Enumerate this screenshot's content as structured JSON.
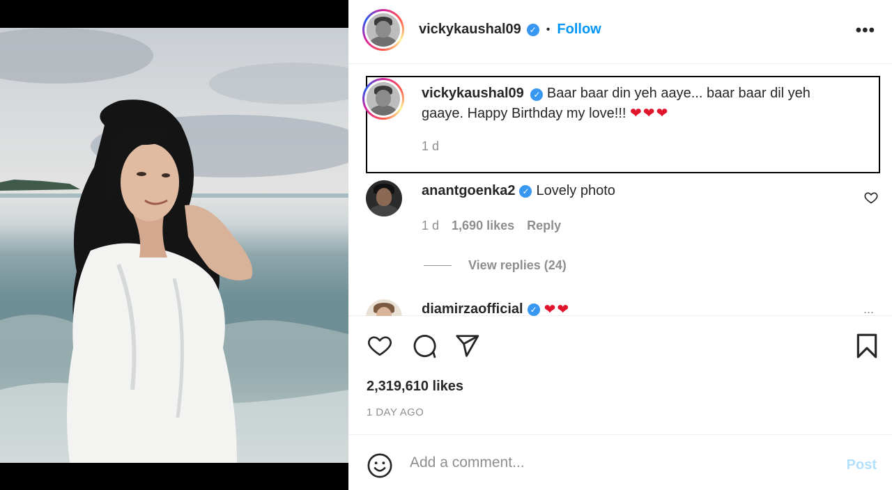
{
  "post": {
    "author": "vickykaushal09",
    "follow_label": "Follow",
    "separator": "•",
    "more_label": "•••",
    "verified_mark": "✓"
  },
  "caption": {
    "username": "vickykaushal09",
    "text": "Baar baar din yeh aaye... baar baar dil yeh gaaye. Happy Birthday my love!!!",
    "hearts": "❤❤❤",
    "time": "1 d"
  },
  "comments": [
    {
      "username": "anantgoenka2",
      "text": "Lovely photo",
      "time": "1 d",
      "likes": "1,690 likes",
      "reply_label": "Reply",
      "view_replies": "View replies (24)"
    },
    {
      "username": "diamirzaofficial",
      "text": "❤❤",
      "more": "..."
    }
  ],
  "stats": {
    "likes": "2,319,610 likes",
    "time_ago": "1 DAY AGO"
  },
  "add_comment": {
    "placeholder": "Add a comment...",
    "post_label": "Post"
  },
  "icons": {
    "like": "heart-icon",
    "comment": "comment-icon",
    "share": "share-icon",
    "save": "bookmark-icon",
    "emoji": "emoji-icon",
    "more": "more-icon"
  },
  "colors": {
    "link": "#0095f6",
    "verified": "#3897f0",
    "muted": "#8e8e8e",
    "post_disabled": "#b2dffc",
    "heart": "#e0142a"
  }
}
